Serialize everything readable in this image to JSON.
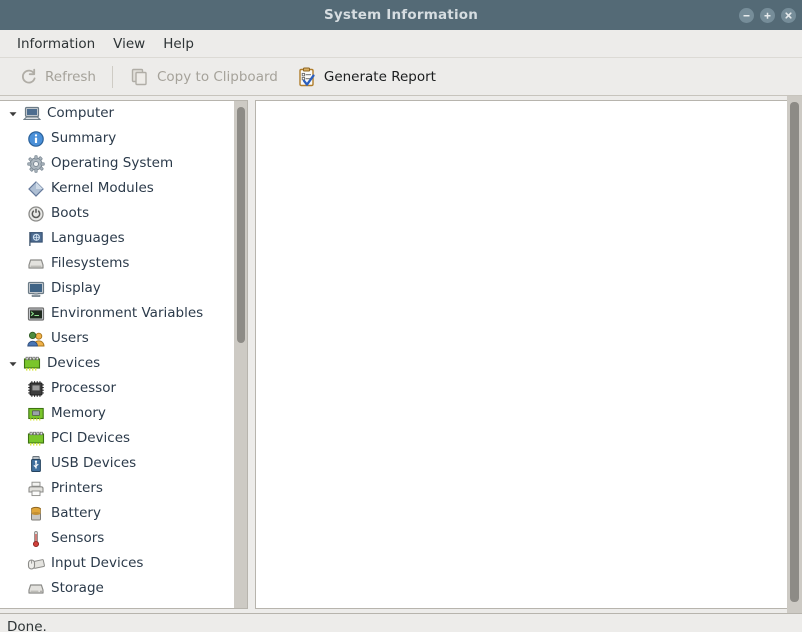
{
  "window": {
    "title": "System Information",
    "controls": [
      {
        "name": "minimize",
        "glyph": "minus"
      },
      {
        "name": "maximize",
        "glyph": "plus"
      },
      {
        "name": "close",
        "glyph": "cross"
      }
    ]
  },
  "menubar": {
    "items": [
      {
        "label": "Information"
      },
      {
        "label": "View"
      },
      {
        "label": "Help"
      }
    ]
  },
  "toolbar": {
    "buttons": [
      {
        "label": "Refresh",
        "icon": "refresh-icon",
        "enabled": false
      },
      {
        "label": "Copy to Clipboard",
        "icon": "copy-icon",
        "enabled": false
      },
      {
        "label": "Generate Report",
        "icon": "report-icon",
        "enabled": true
      }
    ]
  },
  "tree": {
    "nodes": [
      {
        "label": "Computer",
        "icon": "computer-icon",
        "level": 0,
        "expanded": true
      },
      {
        "label": "Summary",
        "icon": "info-icon",
        "level": 1
      },
      {
        "label": "Operating System",
        "icon": "gear-icon",
        "level": 1
      },
      {
        "label": "Kernel Modules",
        "icon": "kernel-icon",
        "level": 1
      },
      {
        "label": "Boots",
        "icon": "power-icon",
        "level": 1
      },
      {
        "label": "Languages",
        "icon": "flag-icon",
        "level": 1
      },
      {
        "label": "Filesystems",
        "icon": "drive-icon",
        "level": 1
      },
      {
        "label": "Display",
        "icon": "monitor-icon",
        "level": 1
      },
      {
        "label": "Environment Variables",
        "icon": "terminal-icon",
        "level": 1
      },
      {
        "label": "Users",
        "icon": "users-icon",
        "level": 1
      },
      {
        "label": "Devices",
        "icon": "devices-icon",
        "level": 0,
        "expanded": true
      },
      {
        "label": "Processor",
        "icon": "cpu-icon",
        "level": 1
      },
      {
        "label": "Memory",
        "icon": "memory-icon",
        "level": 1
      },
      {
        "label": "PCI Devices",
        "icon": "pci-icon",
        "level": 1
      },
      {
        "label": "USB Devices",
        "icon": "usb-icon",
        "level": 1
      },
      {
        "label": "Printers",
        "icon": "printer-icon",
        "level": 1
      },
      {
        "label": "Battery",
        "icon": "battery-icon",
        "level": 1
      },
      {
        "label": "Sensors",
        "icon": "thermometer-icon",
        "level": 1
      },
      {
        "label": "Input Devices",
        "icon": "input-icon",
        "level": 1
      },
      {
        "label": "Storage",
        "icon": "storage-icon",
        "level": 1
      }
    ]
  },
  "content": {
    "text": ""
  },
  "statusbar": {
    "text": "Done."
  },
  "colors": {
    "titlebar": "#546a76",
    "title_text": "#d6dde1",
    "chrome": "#edecea",
    "tree_text": "#2b3a4a",
    "disabled_text": "#a5a29a",
    "pane_background": "#ffffff"
  }
}
